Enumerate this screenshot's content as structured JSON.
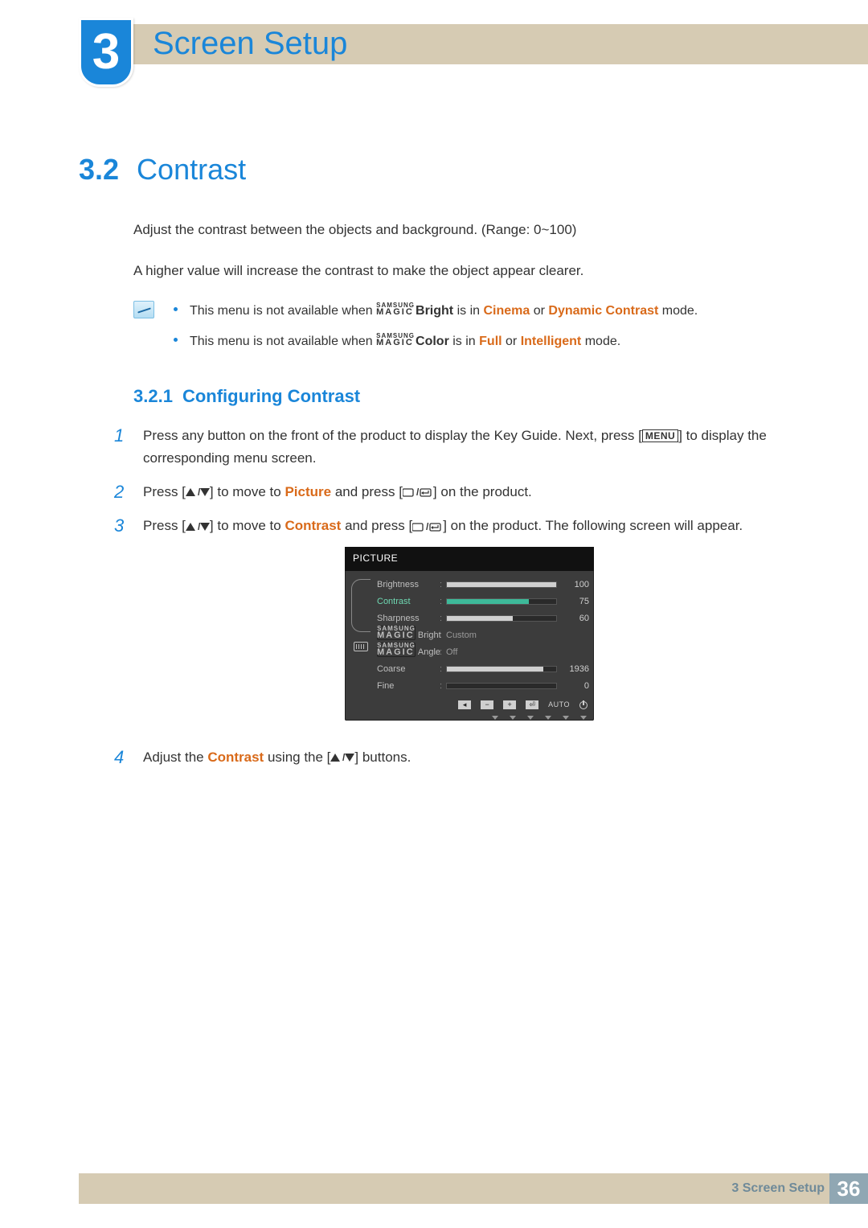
{
  "header": {
    "chapter_number": "3",
    "chapter_title": "Screen Setup"
  },
  "section": {
    "number": "3.2",
    "title": "Contrast",
    "intro1": "Adjust the contrast between the objects and background. (Range: 0~100)",
    "intro2": "A higher value will increase the contrast to make the object appear clearer."
  },
  "notes": {
    "magic_top": "SAMSUNG",
    "magic_bottom": "MAGIC",
    "item1": {
      "before": "This menu is not available when ",
      "bright": "Bright",
      "mid1": " is in ",
      "cinema": "Cinema",
      "or": " or ",
      "dynamic": "Dynamic Contrast",
      "after": " mode."
    },
    "item2": {
      "before": "This menu is not available when ",
      "color": "Color",
      "mid1": " is in ",
      "full": "Full",
      "or": " or ",
      "intelligent": "Intelligent",
      "after": " mode."
    }
  },
  "subsection": {
    "number": "3.2.1",
    "title": "Configuring Contrast"
  },
  "steps": {
    "s1a": "Press any button on the front of the product to display the Key Guide. Next, press [",
    "menu_btn": "MENU",
    "s1b": "] to display the corresponding menu screen.",
    "s2a": "Press [",
    "s2b": "] to move to ",
    "s2_picture": "Picture",
    "s2c": " and press [",
    "s2d": "] on the product.",
    "s3a": "Press [",
    "s3b": "] to move to ",
    "s3_contrast": "Contrast",
    "s3c": " and press [",
    "s3d": "] on the product. The following screen will appear.",
    "s4a": "Adjust the ",
    "s4_contrast": "Contrast",
    "s4b": " using the [",
    "s4c": "] buttons."
  },
  "osd": {
    "title": "PICTURE",
    "rows": [
      {
        "label": "Brightness",
        "type": "bar",
        "value": 100,
        "max": 100,
        "selected": false
      },
      {
        "label": "Contrast",
        "type": "bar",
        "value": 75,
        "max": 100,
        "selected": true
      },
      {
        "label": "Sharpness",
        "type": "bar",
        "value": 60,
        "max": 100,
        "selected": false
      },
      {
        "label": "Bright",
        "type": "magic_text",
        "text": "Custom"
      },
      {
        "label": "Angle",
        "type": "magic_text",
        "text": "Off"
      },
      {
        "label": "Coarse",
        "type": "bar",
        "value": 1936,
        "max": 2200,
        "selected": false
      },
      {
        "label": "Fine",
        "type": "bar",
        "value": 0,
        "max": 100,
        "selected": false,
        "empty": true
      }
    ],
    "auto_label": "AUTO"
  },
  "footer": {
    "label": "Screen Setup",
    "chapter": "3",
    "page_number": "36"
  }
}
